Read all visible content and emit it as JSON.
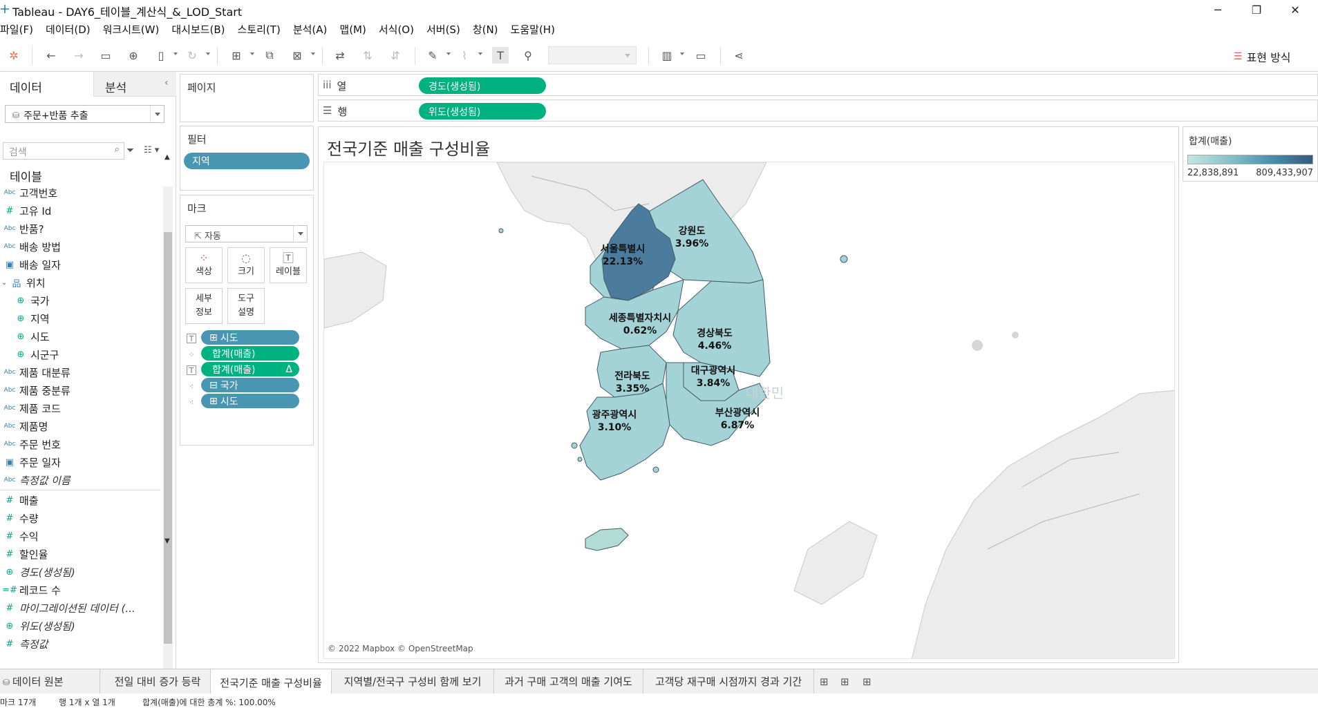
{
  "window": {
    "title": "Tableau - DAY6_테이블_계산식_&_LOD_Start",
    "minimize_icon": "minimize-icon",
    "maximize_icon": "restore-icon",
    "close_icon": "close-icon"
  },
  "menu": [
    "파일(F)",
    "데이터(D)",
    "워크시트(W)",
    "대시보드(B)",
    "스토리(T)",
    "분석(A)",
    "맵(M)",
    "서식(O)",
    "서버(S)",
    "창(N)",
    "도움말(H)"
  ],
  "toolbar": {
    "show_me_label": "표현 방식"
  },
  "datapane": {
    "tab_data": "데이터",
    "tab_analysis": "분석",
    "datasource": "주문+반품 추출",
    "search_placeholder": "검색",
    "tables_label": "테이블",
    "fields": [
      {
        "type": "abc",
        "label": "고객번호"
      },
      {
        "type": "num",
        "label": "고유 Id"
      },
      {
        "type": "abc",
        "label": "반품?"
      },
      {
        "type": "abc",
        "label": "배송 방법"
      },
      {
        "type": "date",
        "label": "배송 일자"
      },
      {
        "type": "hier",
        "label": "위치"
      },
      {
        "type": "geo",
        "label": "국가",
        "indent": true
      },
      {
        "type": "geo",
        "label": "지역",
        "indent": true
      },
      {
        "type": "geo",
        "label": "시도",
        "indent": true
      },
      {
        "type": "geo",
        "label": "시군구",
        "indent": true
      },
      {
        "type": "abc",
        "label": "제품 대분류"
      },
      {
        "type": "abc",
        "label": "제품 중분류"
      },
      {
        "type": "abc",
        "label": "제품 코드"
      },
      {
        "type": "abc",
        "label": "제품명"
      },
      {
        "type": "abc",
        "label": "주문 번호"
      },
      {
        "type": "date",
        "label": "주문 일자"
      },
      {
        "type": "abc",
        "label": "측정값 이름",
        "italic": true
      },
      {
        "type": "num",
        "label": "매출"
      },
      {
        "type": "num",
        "label": "수량"
      },
      {
        "type": "num",
        "label": "수익"
      },
      {
        "type": "num",
        "label": "할인율"
      },
      {
        "type": "geo",
        "label": "경도(생성됨)",
        "italic": true
      },
      {
        "type": "numc",
        "label": "레코드 수"
      },
      {
        "type": "num",
        "label": "마이그레이션된 데이터 (...",
        "italic": true
      },
      {
        "type": "geo",
        "label": "위도(생성됨)",
        "italic": true
      },
      {
        "type": "num",
        "label": "측정값",
        "italic": true
      }
    ]
  },
  "cards": {
    "pages_title": "페이지",
    "filters_title": "필터",
    "filter_pill": "지역",
    "marks_title": "마크",
    "mark_type": "자동",
    "mark_buttons": {
      "color": "색상",
      "size": "크기",
      "label": "레이블",
      "detail_1": "세부",
      "detail_2": "정보",
      "tooltip_1": "도구",
      "tooltip_2": "설명"
    },
    "mark_pills": [
      {
        "label": "시도",
        "color": "#4996b2",
        "icon": "label-text-icon",
        "prefix": "⊞"
      },
      {
        "label": "합계(매출)",
        "color": "#00b280",
        "icon": "color-dots-icon",
        "prefix": ""
      },
      {
        "label": "합계(매출)",
        "color": "#00b280",
        "icon": "label-text-icon",
        "prefix": "",
        "delta": "Δ"
      },
      {
        "label": "국가",
        "color": "#4996b2",
        "icon": "detail-dots-icon",
        "prefix": "⊟"
      },
      {
        "label": "시도",
        "color": "#4996b2",
        "icon": "detail-dots-icon",
        "prefix": "⊞"
      }
    ]
  },
  "shelves": {
    "columns_label": "열",
    "columns_pill": "경도(생성됨)",
    "rows_label": "행",
    "rows_pill": "위도(생성됨)"
  },
  "viz": {
    "title": "전국기준 매출 구성비율",
    "attribution": "© 2022 Mapbox © OpenStreetMap",
    "ghost_label": "대한민",
    "regions": [
      {
        "name": "서울특별시",
        "pct": "22.13%"
      },
      {
        "name": "강원도",
        "pct": "3.96%"
      },
      {
        "name": "세종특별자치시",
        "pct": "0.62%"
      },
      {
        "name": "경상북도",
        "pct": "4.46%"
      },
      {
        "name": "전라북도",
        "pct": "3.35%"
      },
      {
        "name": "대구광역시",
        "pct": "3.84%"
      },
      {
        "name": "부산광역시",
        "pct": "6.87%"
      },
      {
        "name": "광주광역시",
        "pct": "3.10%"
      }
    ]
  },
  "legend": {
    "title": "합계(매출)",
    "min": "22,838,891",
    "max": "809,433,907",
    "color_low": "#c4e6e0",
    "color_high": "#335a7f"
  },
  "sheet_tabs": {
    "datasource": "데이터 원본",
    "tabs": [
      "전일 대비 증가 등락",
      "전국기준 매출 구성비율",
      "지역별/전국구 구성비 함께 보기",
      "과거 구매 고객의 매출 기여도",
      "고객당 재구매 시점까지 경과 기간"
    ]
  },
  "status": {
    "marks": "마크 17개",
    "rows_cols": "행 1개 x 열 1개",
    "summary": "합계(매출)에 대한 총계 %: 100.00%"
  }
}
